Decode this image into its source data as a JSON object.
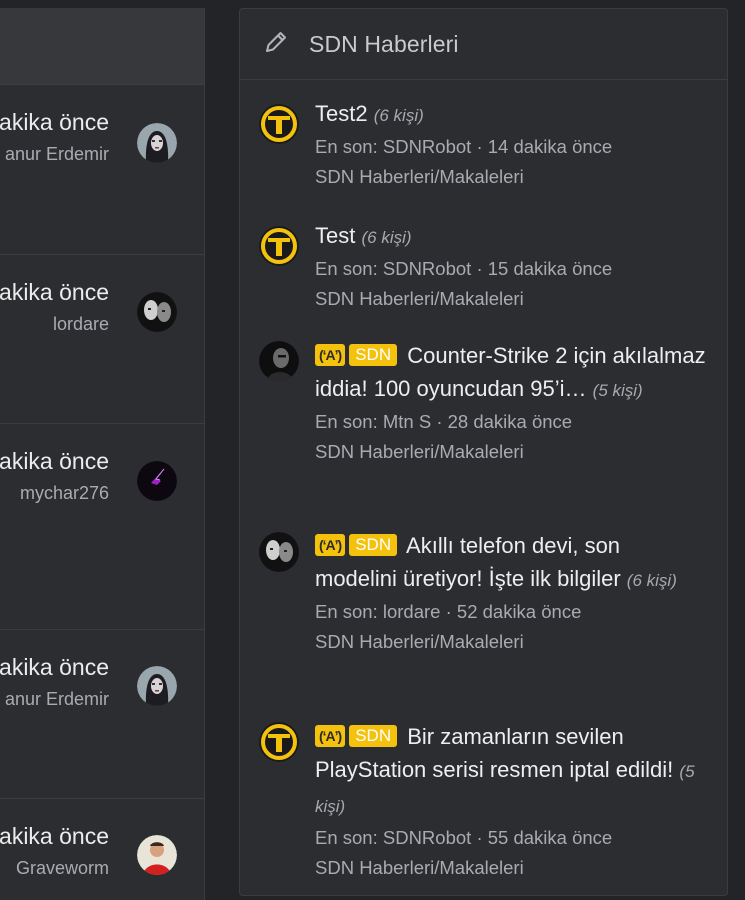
{
  "left_panel": {
    "items": [
      {
        "time": "akika önce",
        "user": "anur Erdemir",
        "avatar": "woman-dark-hair-avatar"
      },
      {
        "time": "akika önce",
        "user": "lordare",
        "avatar": "bw-portrait-avatar"
      },
      {
        "time": "akika önce",
        "user": "mychar276",
        "avatar": "purple-lightning-avatar"
      },
      {
        "time": "akika önce",
        "user": "anur Erdemir",
        "avatar": "woman-dark-hair-avatar"
      },
      {
        "time": "akika önce",
        "user": "Graveworm",
        "avatar": "red-shirt-man-avatar"
      }
    ]
  },
  "right_panel": {
    "title": "SDN Haberleri",
    "title_icon": "pencil-icon",
    "badge_sdn": "SDN",
    "badge_icon": "(ʻAʼ)",
    "threads": [
      {
        "title": "Test2",
        "count": "(6 kişi)",
        "last_by": "En son: SDNRobot · 14 dakika önce",
        "forum": "SDN Haberleri/Makaleleri",
        "avatar": "sdn-logo-avatar",
        "badges": false
      },
      {
        "title": "Test",
        "count": "(6 kişi)",
        "last_by": "En son: SDNRobot · 15 dakika önce",
        "forum": "SDN Haberleri/Makaleleri",
        "avatar": "sdn-logo-avatar",
        "badges": false
      },
      {
        "title": "Counter-Strike 2 için akılalmaz iddia! 100 oyuncudan 95’i…",
        "count": "(5 kişi)",
        "last_by": "En son: Mtn S · 28 dakika önce",
        "forum": "SDN Haberleri/Makaleleri",
        "avatar": "dark-portrait-avatar",
        "badges": true
      },
      {
        "title": "Akıllı telefon devi, son modelini üretiyor! İşte ilk bilgiler",
        "count": "(6 kişi)",
        "last_by": "En son: lordare · 52 dakika önce",
        "forum": "SDN Haberleri/Makaleleri",
        "avatar": "bw-portrait-avatar",
        "badges": true
      },
      {
        "title": "Bir zamanların sevilen PlayStation serisi resmen iptal edildi!",
        "count": "(5 kişi)",
        "last_by": "En son: SDNRobot · 55 dakika önce",
        "forum": "SDN Haberleri/Makaleleri",
        "avatar": "sdn-logo-avatar",
        "badges": true
      }
    ]
  },
  "colors": {
    "background": "#232428",
    "panel": "#2b2d31",
    "badge": "#f4c20d",
    "muted_text": "#a9abb0"
  }
}
